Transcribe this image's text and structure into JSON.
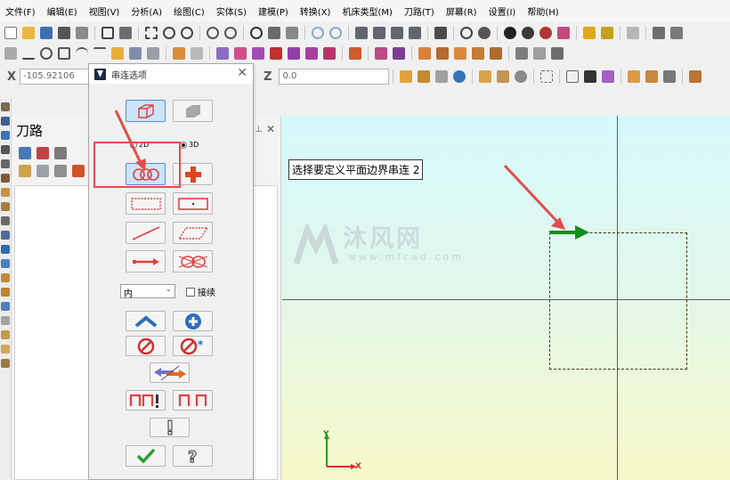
{
  "menu": [
    "文件(F)",
    "编辑(E)",
    "视图(V)",
    "分析(A)",
    "绘图(C)",
    "实体(S)",
    "建模(P)",
    "转换(X)",
    "机床类型(M)",
    "刀路(T)",
    "屏幕(R)",
    "设置(I)",
    "帮助(H)"
  ],
  "coords": {
    "x_label": "X",
    "x_value": "-105.92106",
    "z_label": "Z",
    "z_value": "0.0"
  },
  "toolpath_panel": {
    "title": "刀路"
  },
  "dialog": {
    "title": "串连选项",
    "radio_2d": "2D",
    "radio_3d": "3D",
    "selected_mode": "3D",
    "dropdown_value": "内",
    "checkbox_label": "接续",
    "checkbox_checked": false
  },
  "graphics": {
    "prompt": "选择要定义平面边界串连 2",
    "watermark_cn": "沐风网",
    "watermark_url": "www.mfcad.com",
    "axis_x": "X",
    "axis_y": "Y"
  },
  "colors": {
    "accent_red": "#e44c4c",
    "selected_blue": "#cce4fa",
    "chain_arrow": "#168d1b"
  }
}
